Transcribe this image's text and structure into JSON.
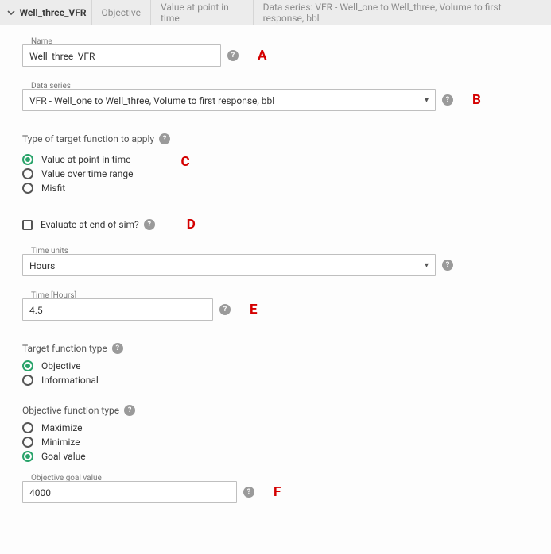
{
  "header": {
    "title": "Well_three_VFR",
    "crumbs": [
      "Objective",
      "Value at point in time",
      "Data series: VFR - Well_one to Well_three, Volume to first response, bbl"
    ]
  },
  "name": {
    "label": "Name",
    "value": "Well_three_VFR"
  },
  "data_series": {
    "label": "Data series",
    "value": "VFR - Well_one to Well_three, Volume to first response, bbl"
  },
  "target_fn": {
    "label": "Type of target function to apply",
    "options": [
      "Value at point in time",
      "Value over time range",
      "Misfit"
    ],
    "selected": 0
  },
  "eval_end": {
    "label": "Evaluate at end of sim?",
    "checked": false
  },
  "time_units": {
    "label": "Time units",
    "value": "Hours"
  },
  "time_value": {
    "label": "Time [Hours]",
    "value": "4.5"
  },
  "target_type": {
    "label": "Target function type",
    "options": [
      "Objective",
      "Informational"
    ],
    "selected": 0
  },
  "obj_type": {
    "label": "Objective function type",
    "options": [
      "Maximize",
      "Minimize",
      "Goal value"
    ],
    "selected": 2
  },
  "goal_value": {
    "label": "Objective goal value",
    "value": "4000"
  },
  "markers": {
    "a": "A",
    "b": "B",
    "c": "C",
    "d": "D",
    "e": "E",
    "f": "F"
  },
  "help_glyph": "?"
}
